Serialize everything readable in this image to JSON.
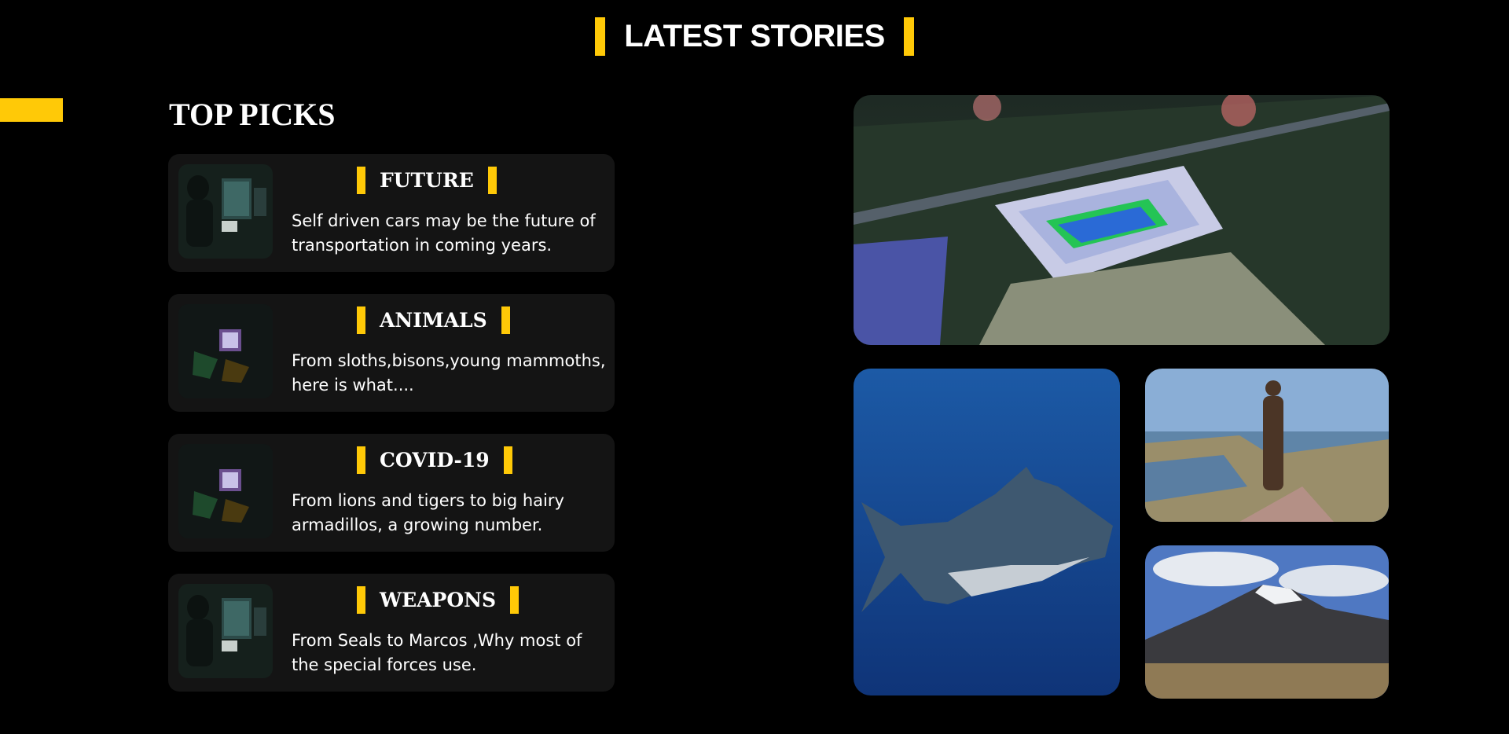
{
  "header": {
    "title": "LATEST STORIES"
  },
  "top_picks": {
    "title": "TOP PICKS",
    "cards": [
      {
        "title": "FUTURE",
        "text": "Self driven cars may be the future of transportation in coming years."
      },
      {
        "title": "ANIMALS",
        "text": "From sloths,bisons,young mammoths, here is what...."
      },
      {
        "title": "COVID-19",
        "text": "From lions and tigers to big hairy armadillos, a growing number."
      },
      {
        "title": "WEAPONS",
        "text": "From Seals to Marcos ,Why most of the special forces use."
      }
    ]
  },
  "colors": {
    "accent": "#ffc907",
    "card_bg": "#141414",
    "page_bg": "#000000"
  }
}
